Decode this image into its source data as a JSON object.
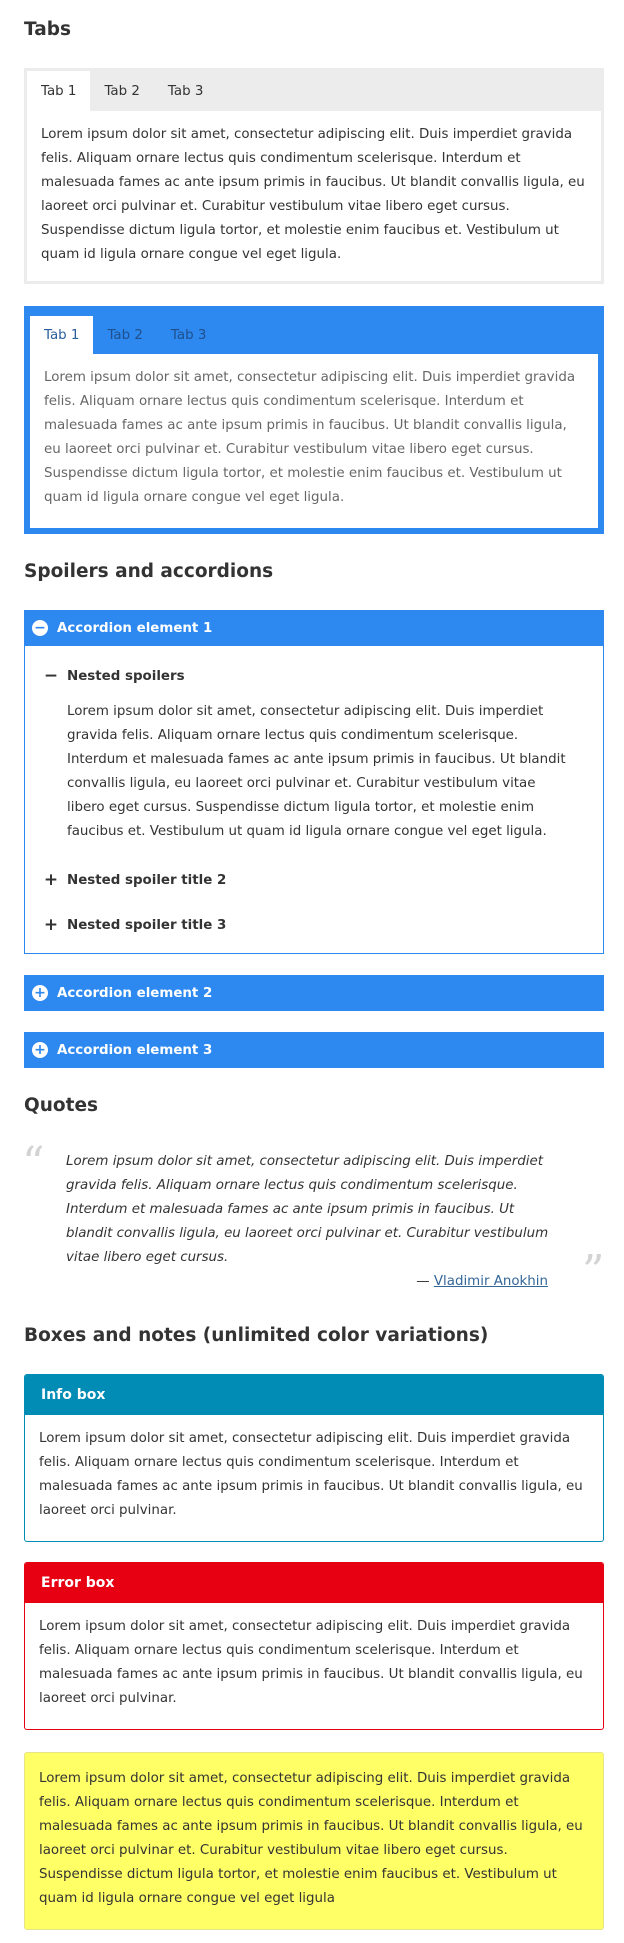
{
  "colors": {
    "accent_blue": "#2d89ef",
    "info": "#008cb4",
    "error": "#e60012",
    "note": "#ffff66"
  },
  "lorem_full": "Lorem ipsum dolor sit amet, consectetur adipiscing elit. Duis imperdiet gravida felis. Aliquam ornare lectus quis condimentum scelerisque. Interdum et malesuada fames ac ante ipsum primis in faucibus. Ut blandit convallis ligula, eu laoreet orci pulvinar et. Curabitur vestibulum vitae libero eget cursus. Suspendisse dictum ligula tortor, et molestie enim faucibus et. Vestibulum ut quam id ligula ornare congue vel eget ligula.",
  "lorem_short": "Lorem ipsum dolor sit amet, consectetur adipiscing elit. Duis imperdiet gravida felis. Aliquam ornare lectus quis condimentum scelerisque. Interdum et malesuada fames ac ante ipsum primis in faucibus. Ut blandit convallis ligula, eu laoreet orci pulvinar.",
  "tabs_section": {
    "title": "Tabs",
    "tabs": [
      "Tab 1",
      "Tab 2",
      "Tab 3"
    ]
  },
  "accordion_section": {
    "title": "Spoilers and accordions",
    "items": [
      {
        "label": "Accordion element 1",
        "icon": "minus-circle-icon"
      },
      {
        "label": "Accordion element 2",
        "icon": "plus-circle-icon"
      },
      {
        "label": "Accordion element 3",
        "icon": "plus-circle-icon"
      }
    ],
    "spoilers": [
      {
        "label": "Nested spoilers",
        "sign": "−"
      },
      {
        "label": "Nested spoiler title 2",
        "sign": "+"
      },
      {
        "label": "Nested spoiler title 3",
        "sign": "+"
      }
    ]
  },
  "quote_section": {
    "title": "Quotes",
    "text": "Lorem ipsum dolor sit amet, consectetur adipiscing elit. Duis imperdiet gravida felis. Aliquam ornare lectus quis condimentum scelerisque. Interdum et malesuada fames ac ante ipsum primis in faucibus. Ut blandit convallis ligula, eu laoreet orci pulvinar et. Curabitur vestibulum vitae libero eget cursus.",
    "cite_prefix": "— ",
    "cite_name": "Vladimir Anokhin",
    "open_mark": "“",
    "close_mark": "”"
  },
  "boxes_section": {
    "title": "Boxes and notes (unlimited color variations)",
    "info_title": "Info box",
    "error_title": "Error box",
    "note_text": "Lorem ipsum dolor sit amet, consectetur adipiscing elit. Duis imperdiet gravida felis. Aliquam ornare lectus quis condimentum scelerisque. Interdum et malesuada fames ac ante ipsum primis in faucibus. Ut blandit convallis ligula, eu laoreet orci pulvinar et. Curabitur vestibulum vitae libero eget cursus. Suspendisse dictum ligula tortor, et molestie enim faucibus et. Vestibulum ut quam id ligula ornare congue vel eget ligula"
  }
}
